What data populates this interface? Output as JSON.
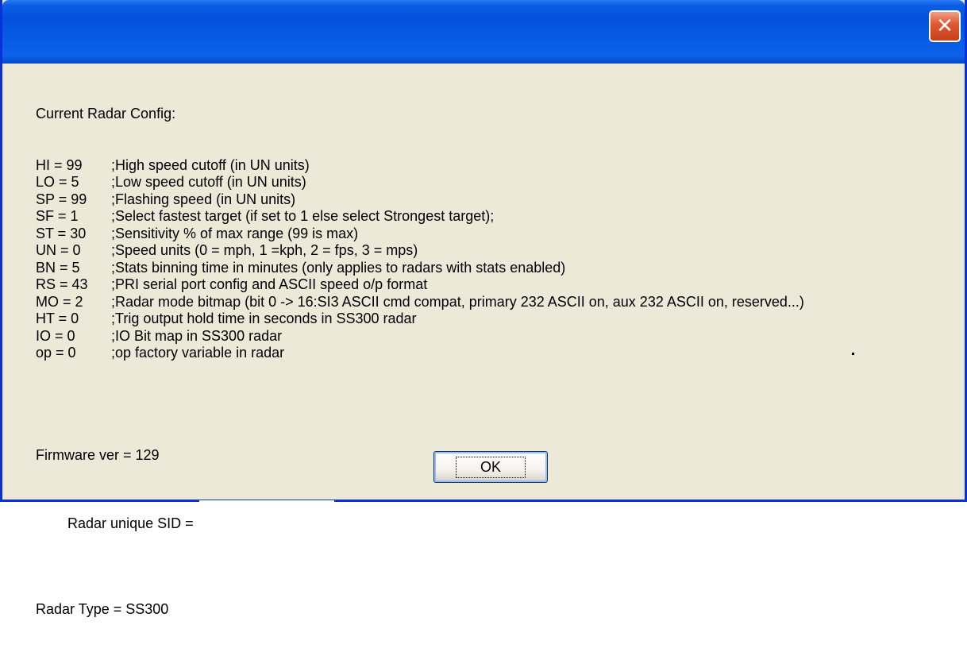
{
  "window": {
    "title": "",
    "close_glyph": "✕"
  },
  "config": {
    "heading": "Current Radar Config:",
    "rows": [
      {
        "key": "HI = 99",
        "comment": ";High speed cutoff (in UN units)"
      },
      {
        "key": "LO = 5",
        "comment": ";Low speed cutoff (in UN units)"
      },
      {
        "key": "SP = 99",
        "comment": ";Flashing speed (in UN units)"
      },
      {
        "key": "SF = 1",
        "comment": ";Select fastest target (if set to 1 else select Strongest target);"
      },
      {
        "key": "ST = 30",
        "comment": ";Sensitivity % of max range (99 is max)"
      },
      {
        "key": "UN = 0",
        "comment": ";Speed units (0 = mph, 1 =kph, 2 = fps, 3 = mps)"
      },
      {
        "key": "BN = 5",
        "comment": ";Stats binning time in minutes (only applies to radars with stats enabled)"
      },
      {
        "key": "RS = 43",
        "comment": ";PRI serial port config and ASCII speed o/p format"
      },
      {
        "key": "MO = 2",
        "comment": ";Radar mode bitmap (bit 0 -> 16:SI3 ASCII cmd compat, primary 232 ASCII on, aux 232 ASCII on, reserved...)"
      },
      {
        "key": "HT = 0",
        "comment": ";Trig output hold time in seconds in SS300 radar"
      },
      {
        "key": "IO = 0",
        "comment": ";IO Bit map in SS300 radar"
      },
      {
        "key": "op = 0",
        "comment": ";op factory variable in radar"
      }
    ],
    "firmware": "Firmware ver = 129",
    "sid_label": "Radar unique SID =",
    "radar_type": "Radar Type = SS300"
  },
  "buttons": {
    "ok_label": "OK"
  },
  "colors": {
    "titlebar_blue": "#0451dc",
    "dialog_background": "#ece9d8",
    "close_red": "#e15a35",
    "frame_border": "#0831d9"
  }
}
